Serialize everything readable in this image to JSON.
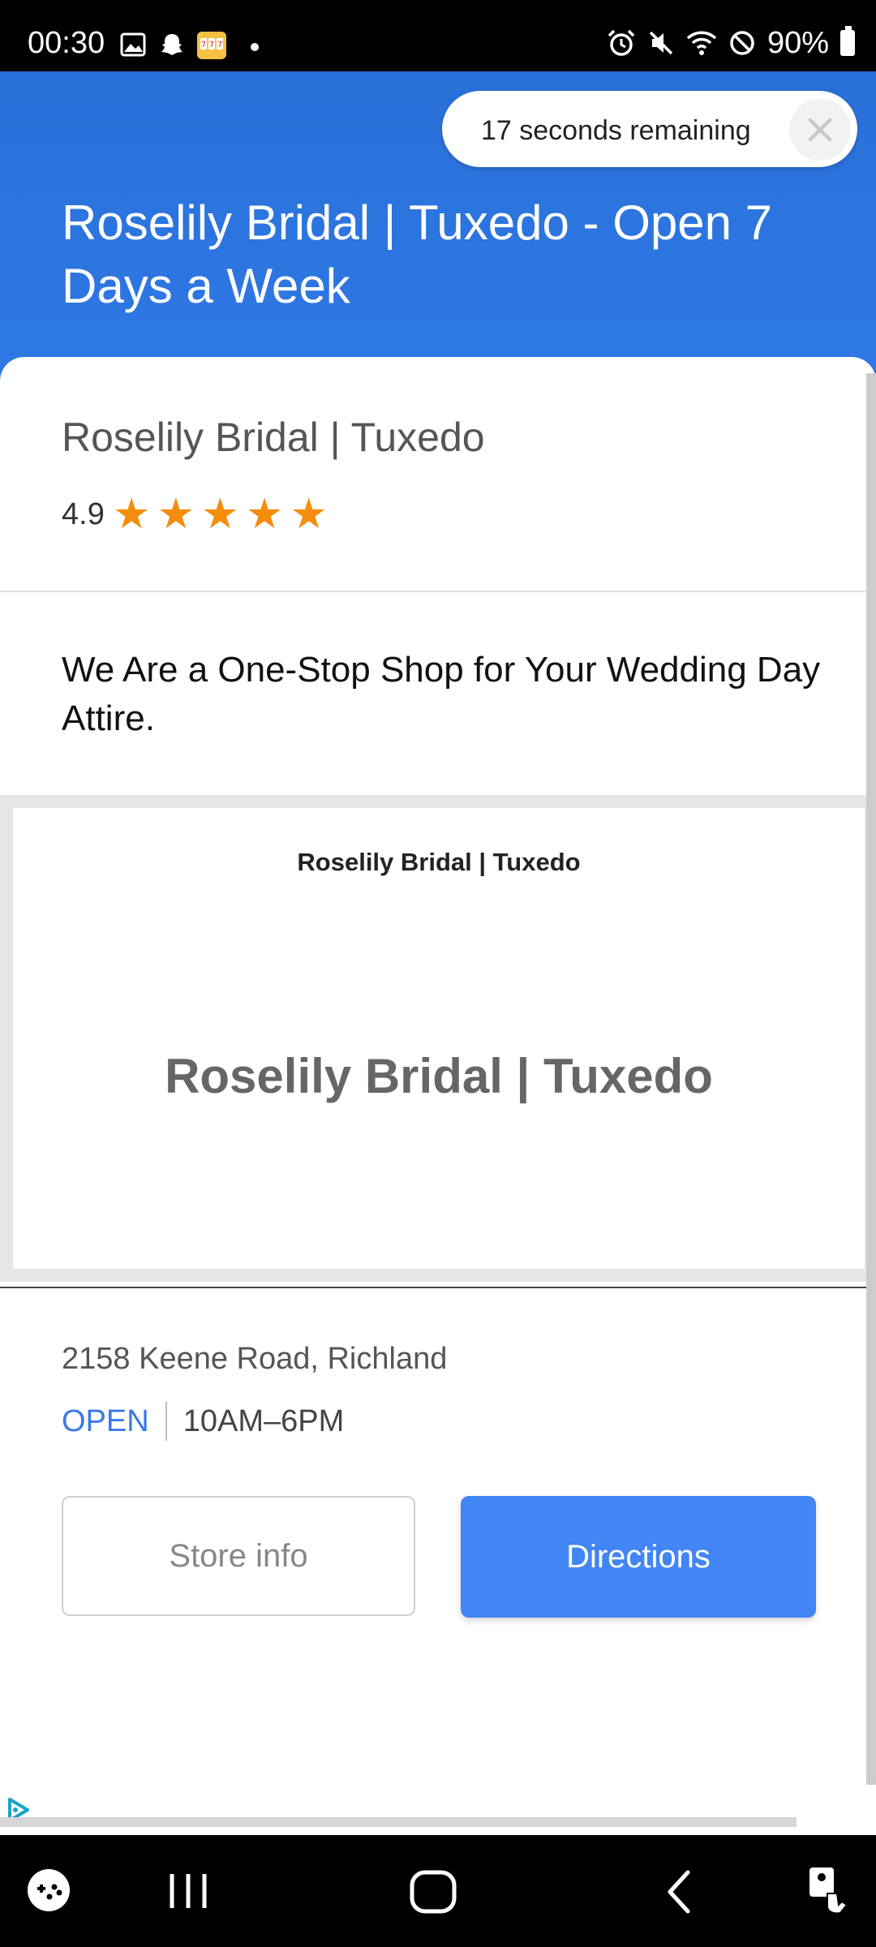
{
  "status_bar": {
    "time": "00:30",
    "battery": "90%",
    "left_icons": [
      "gallery-icon",
      "snapchat-icon",
      "slot-game-icon",
      "dot-icon"
    ],
    "right_icons": [
      "alarm-icon",
      "mute-icon",
      "wifi-icon",
      "do-not-disturb-icon",
      "battery-icon"
    ]
  },
  "ad": {
    "countdown_text": "17 seconds remaining",
    "title": "Roselily Bridal | Tuxedo - Open 7 Days a Week",
    "accent_color": "#2f7ae6"
  },
  "business": {
    "name": "Roselily Bridal | Tuxedo",
    "rating": "4.9",
    "stars": 5,
    "star_color": "#f58d0c",
    "tagline": "We Are a One-Stop Shop for Your Wedding Day Attire.",
    "image_small_text": "Roselily Bridal | Tuxedo",
    "image_large_text": "Roselily Bridal | Tuxedo",
    "address": "2158 Keene Road, Richland",
    "open_status": "OPEN",
    "hours": "10AM–6PM"
  },
  "buttons": {
    "store_info": "Store info",
    "directions": "Directions",
    "directions_color": "#4285f4"
  },
  "nav_bar": {
    "items": [
      "game-launcher-icon",
      "recent-apps-icon",
      "home-icon",
      "back-icon",
      "accessibility-icon"
    ]
  }
}
